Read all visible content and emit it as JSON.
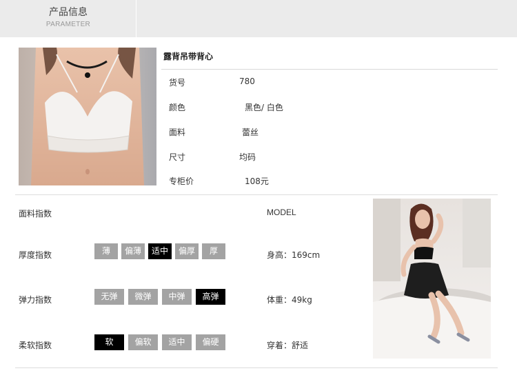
{
  "header": {
    "title": "产品信息",
    "subtitle": "PARAMETER"
  },
  "product": {
    "name": "露背吊带背心",
    "specs": [
      {
        "label": "货号",
        "value": "780"
      },
      {
        "label": "颜色",
        "value": "黑色/ 白色"
      },
      {
        "label": "面料",
        "value": "蕾丝"
      },
      {
        "label": "尺寸",
        "value": "均码"
      },
      {
        "label": "专柜价",
        "value": "108元"
      }
    ]
  },
  "fabric_index": {
    "title": "面料指数",
    "rows": [
      {
        "label": "厚度指数",
        "options": [
          "薄",
          "偏薄",
          "适中",
          "偏厚",
          "厚"
        ],
        "selected": "适中"
      },
      {
        "label": "弹力指数",
        "options": [
          "无弹",
          "微弹",
          "中弹",
          "高弹"
        ],
        "selected": "高弹"
      },
      {
        "label": "柔软指数",
        "options": [
          "软",
          "偏软",
          "适中",
          "偏硬"
        ],
        "selected": "软"
      }
    ]
  },
  "model": {
    "title": "MODEL",
    "height": "身高：169cm",
    "weight": "体重：49kg",
    "fit": "穿着：舒适"
  },
  "colors": {
    "header_bg": "#ebebeb",
    "pill_default": "#a3a3a3",
    "pill_active": "#000000"
  }
}
